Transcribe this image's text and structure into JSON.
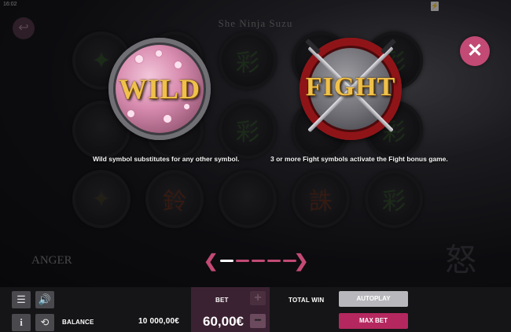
{
  "status": {
    "time": "16:02",
    "battery_icon": "battery-charging-icon"
  },
  "game": {
    "title": "She Ninja Suzu"
  },
  "reels": {
    "symbols": [
      {
        "glyph": "✦",
        "color": "green"
      },
      {
        "glyph": "✧",
        "color": "purple"
      },
      {
        "glyph": "彩",
        "color": "green"
      },
      {
        "glyph": "",
        "color": "gold"
      },
      {
        "glyph": "彩",
        "color": "green"
      },
      {
        "glyph": "",
        "color": "purple"
      },
      {
        "glyph": "",
        "color": "gold"
      },
      {
        "glyph": "彩",
        "color": "green"
      },
      {
        "glyph": "",
        "color": "gold"
      },
      {
        "glyph": "彩",
        "color": "green"
      },
      {
        "glyph": "✦",
        "color": "gold"
      },
      {
        "glyph": "鈴",
        "color": "red"
      },
      {
        "glyph": "",
        "color": "purple"
      },
      {
        "glyph": "誅",
        "color": "red"
      },
      {
        "glyph": "彩",
        "color": "green"
      }
    ]
  },
  "info": {
    "wild_label": "WILD",
    "wild_desc": "Wild symbol substitutes for any other symbol.",
    "fight_label": "FIGHT",
    "fight_desc": "3 or more Fight symbols activate the Fight bonus game."
  },
  "pager": {
    "count": 5,
    "active_index": 0
  },
  "background": {
    "side_label": "ANGER",
    "side_kanji": "怒"
  },
  "footer": {
    "menu_icon": "menu-icon",
    "sound_icon": "speaker-icon",
    "info_label": "i",
    "history_icon": "history-icon",
    "balance_label": "BALANCE",
    "balance_value": "10 000,00€",
    "bet_label": "BET",
    "bet_value": "60,00€",
    "plus_label": "+",
    "minus_label": "−",
    "total_win_label": "TOTAL WIN",
    "autoplay_label": "AUTOPLAY",
    "maxbet_label": "MAX BET"
  },
  "colors": {
    "accent": "#c24a74",
    "gold": "#f0c14a",
    "footer": "#151517"
  }
}
